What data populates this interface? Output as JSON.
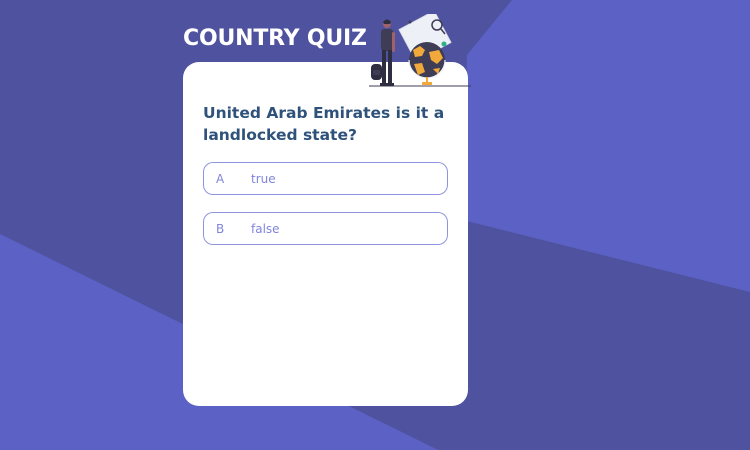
{
  "colors": {
    "background_light": "#5c61c6",
    "background_dark": "#4f539f",
    "card": "#ffffff",
    "question_text": "#2f527b",
    "option_border": "#6066d0",
    "option_text": "#6066d0",
    "globe_land": "#f2a93b",
    "globe_ocean": "#3f3d56"
  },
  "quiz": {
    "title": "COUNTRY QUIZ",
    "question": "United Arab Emirates is it a landlocked state?",
    "options": [
      {
        "letter": "A",
        "text": "true"
      },
      {
        "letter": "B",
        "text": "false"
      }
    ]
  },
  "illustration": {
    "icon": "traveler-with-globe-icon"
  }
}
